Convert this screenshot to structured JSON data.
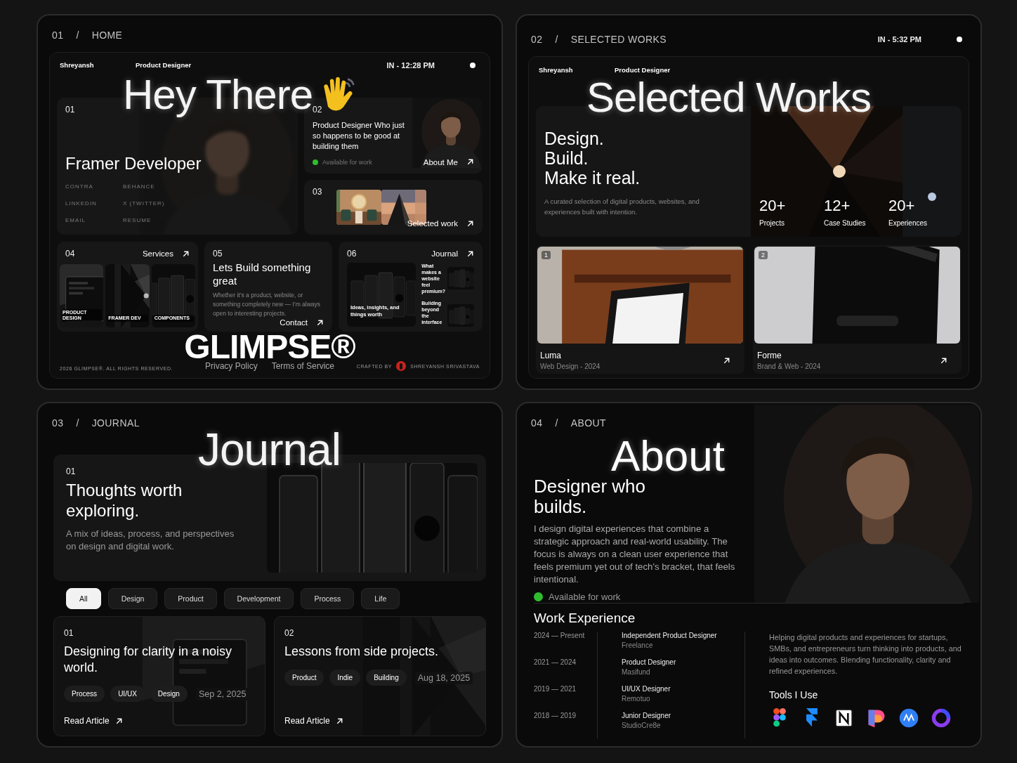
{
  "home": {
    "crumb": [
      "01",
      "/",
      "HOME"
    ],
    "header": {
      "name": "Shreyansh",
      "role": "Product Designer",
      "time": "IN - 12:28 PM"
    },
    "headline": "Hey There",
    "intro_card": {
      "index": "01",
      "title": "Framer Developer",
      "links": [
        "CONTRA",
        "BEHANCE",
        "LINKEDIN",
        "X (TWITTER)",
        "EMAIL",
        "RESUME"
      ]
    },
    "about_card": {
      "index": "02",
      "text": "Product Designer Who just so happens to be good at building them",
      "status": "Available for work",
      "link": "About Me"
    },
    "work_card": {
      "index": "03",
      "link": "Selected work"
    },
    "services_card": {
      "index": "04",
      "link": "Services",
      "items": [
        "PRODUCT DESIGN",
        "FRAMER DEV",
        "COMPONENTS"
      ]
    },
    "contact_card": {
      "index": "05",
      "title": "Lets Build something great",
      "text": "Whether it’s a product, website, or something completely new — I’m always open to interesting projects.",
      "link": "Contact"
    },
    "journal_card": {
      "index": "06",
      "link": "Journal",
      "feature": "Ideas, insights, and things worth",
      "posts": [
        "What makes a website feel premium?",
        "Building beyond the interface"
      ]
    },
    "footer": {
      "copyright": "2026 GLIMPSE®. ALL RIGHTS RESERVED.",
      "brand": "GLIMPSE®",
      "links": [
        "Privacy Policy",
        "Terms of Service"
      ],
      "credit_label": "CRAFTED BY",
      "credit_name": "SHREYANSH SRIVASTAVA"
    }
  },
  "works": {
    "crumb": [
      "02",
      "/",
      "SELECTED WORKS"
    ],
    "time": "IN - 5:32 PM",
    "header": {
      "name": "Shreyansh",
      "role": "Product Designer"
    },
    "headline": "Selected Works",
    "hero": {
      "lines": [
        "Design.",
        "Build.",
        "Make it real."
      ],
      "text": "A curated selection of digital products, websites, and experiences built with intention.",
      "stats": [
        {
          "value": "20+",
          "label": "Projects"
        },
        {
          "value": "12+",
          "label": "Case Studies"
        },
        {
          "value": "20+",
          "label": "Experiences"
        }
      ]
    },
    "projects": [
      {
        "number": "1",
        "name": "Luma",
        "meta": "Web Design - 2024"
      },
      {
        "number": "2",
        "name": "Forme",
        "meta": "Brand & Web - 2024"
      }
    ]
  },
  "journal": {
    "crumb": [
      "03",
      "/",
      "JOURNAL"
    ],
    "headline": "Journal",
    "hero": {
      "index": "01",
      "title": "Thoughts worth exploring.",
      "text": "A mix of ideas, process, and perspectives on design and digital work."
    },
    "filters": [
      {
        "label": "All",
        "selected": true
      },
      {
        "label": "Design",
        "selected": false
      },
      {
        "label": "Product",
        "selected": false
      },
      {
        "label": "Development",
        "selected": false
      },
      {
        "label": "Process",
        "selected": false
      },
      {
        "label": "Life",
        "selected": false
      }
    ],
    "articles": [
      {
        "index": "01",
        "title": "Designing for clarity in a noisy world.",
        "tags": [
          "Process",
          "UI/UX",
          "Design"
        ],
        "date": "Sep 2, 2025",
        "link": "Read Article"
      },
      {
        "index": "02",
        "title": "Lessons from side projects.",
        "tags": [
          "Product",
          "Indie",
          "Building"
        ],
        "date": "Aug 18, 2025",
        "link": "Read Article"
      }
    ]
  },
  "about": {
    "crumb": [
      "04",
      "/",
      "ABOUT"
    ],
    "headline": "About",
    "title": "Designer who builds.",
    "text": "I design digital experiences that combine a strategic approach and real-world usability. The focus is always on a clean user experience that feels premium yet out of tech’s bracket, that feels intentional.",
    "status": "Available for work",
    "experience_title": "Work Experience",
    "experience": [
      {
        "period": "2024 — Present",
        "role": "Independent Product Designer",
        "company": "Freelance"
      },
      {
        "period": "2021 — 2024",
        "role": "Product Designer",
        "company": "Masifund"
      },
      {
        "period": "2019 — 2021",
        "role": "UI/UX Designer",
        "company": "Remotuo"
      },
      {
        "period": "2018 — 2019",
        "role": "Junior Designer",
        "company": "StudioCre8e"
      }
    ],
    "summary": "Helping digital products and experiences for startups, SMBs, and entrepreneurs turn thinking into products, and ideas into outcomes. Blending functionality, clarity and refined experiences.",
    "tools_title": "Tools I Use"
  }
}
